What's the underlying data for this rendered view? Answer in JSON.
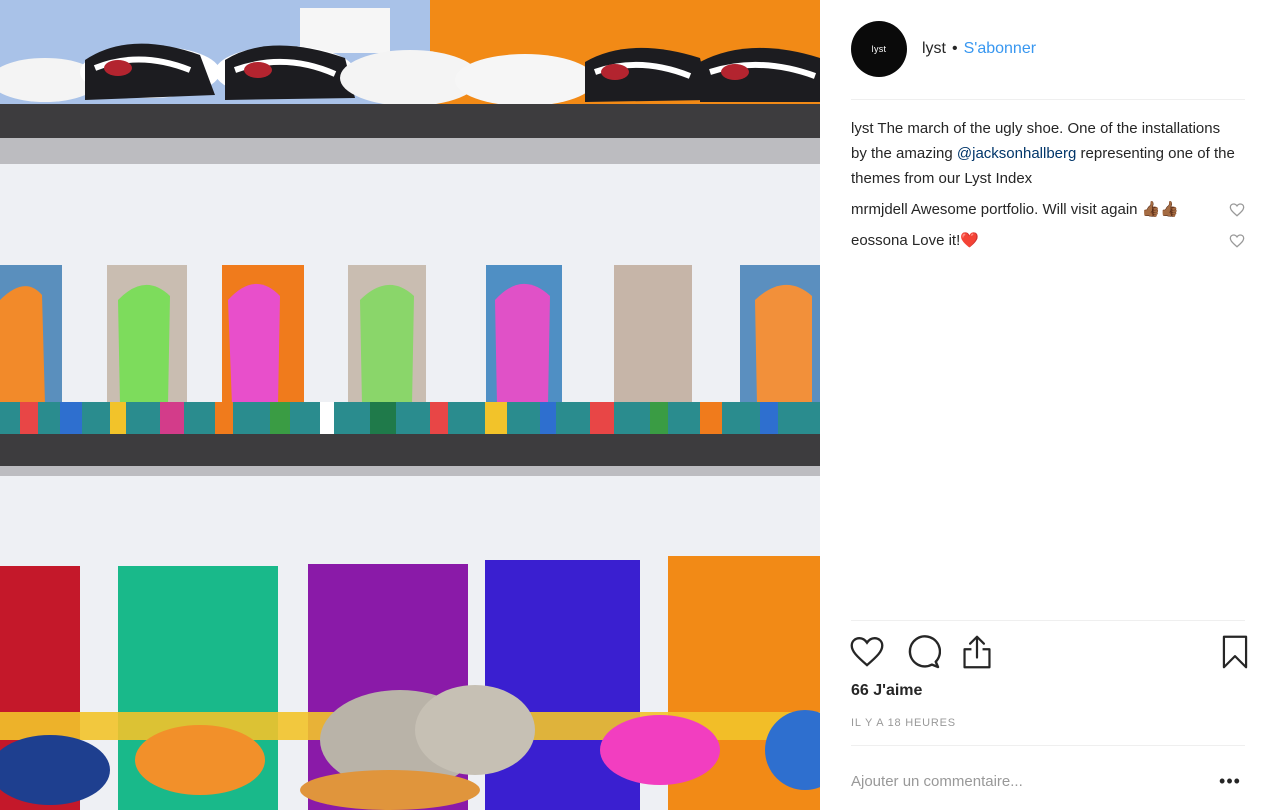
{
  "post": {
    "image_alt": "shoe installation shelves",
    "header": {
      "avatar_text": "lyst",
      "username": "lyst",
      "separator": "•",
      "follow_label": "S'abonner"
    },
    "caption": {
      "username": "lyst",
      "text_part1": "The march of the ugly shoe. One of the installations by the amazing",
      "mention": "@jacksonhallberg",
      "text_part2": "representing one of the themes from our Lyst Index"
    },
    "comments": [
      {
        "username": "mrmjdell",
        "text": "Awesome portfolio. Will visit again 👍🏾👍🏾"
      },
      {
        "username": "eossona",
        "text": "Love it!❤️"
      }
    ],
    "likes": "66 J'aime",
    "timestamp": "IL Y A 18 HEURES",
    "add_comment_placeholder": "Ajouter un commentaire...",
    "more_label": "•••"
  },
  "colors": {
    "link": "#3897f0",
    "mention": "#003569",
    "text": "#262626",
    "muted": "#999999"
  },
  "icons": [
    "heart-icon",
    "comment-icon",
    "share-icon",
    "bookmark-icon",
    "comment-like-icon"
  ]
}
